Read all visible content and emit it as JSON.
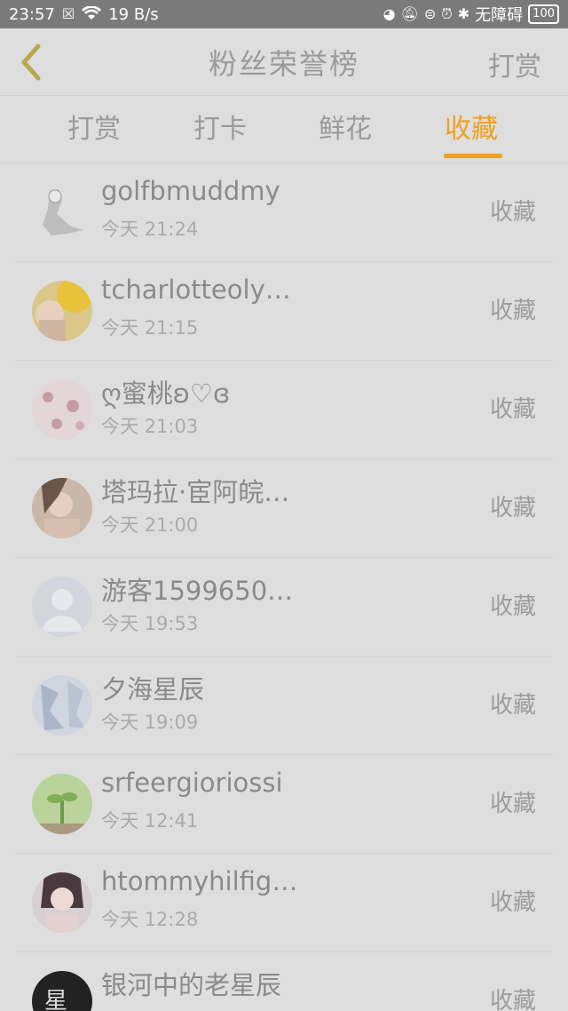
{
  "status_bar": {
    "time": "23:57",
    "network_speed": "19 B/s",
    "accessibility": "无障碍",
    "battery": "100"
  },
  "header": {
    "title": "粉丝荣誉榜",
    "action": "打赏"
  },
  "tabs": [
    {
      "label": "打赏"
    },
    {
      "label": "打卡"
    },
    {
      "label": "鲜花"
    },
    {
      "label": "收藏"
    }
  ],
  "accent_color": "#f0a020",
  "rows": [
    {
      "name": "golfbmuddmy",
      "time": "今天 21:24",
      "action": "收藏"
    },
    {
      "name": "tcharlotteoly…",
      "time": "今天 21:15",
      "action": "收藏"
    },
    {
      "name": "ღ蜜桃ʚ♡ɞ",
      "time": "今天 21:03",
      "action": "收藏"
    },
    {
      "name": "塔玛拉·宦阿皖…",
      "time": "今天 21:00",
      "action": "收藏"
    },
    {
      "name": "游客1599650…",
      "time": "今天 19:53",
      "action": "收藏"
    },
    {
      "name": "夕海星辰",
      "time": "今天 19:09",
      "action": "收藏"
    },
    {
      "name": "srfeergioriossi",
      "time": "今天 12:41",
      "action": "收藏"
    },
    {
      "name": "htommyhilfig…",
      "time": "今天 12:28",
      "action": "收藏"
    },
    {
      "name": "银河中的老星辰",
      "time": "",
      "action": "收藏"
    }
  ]
}
